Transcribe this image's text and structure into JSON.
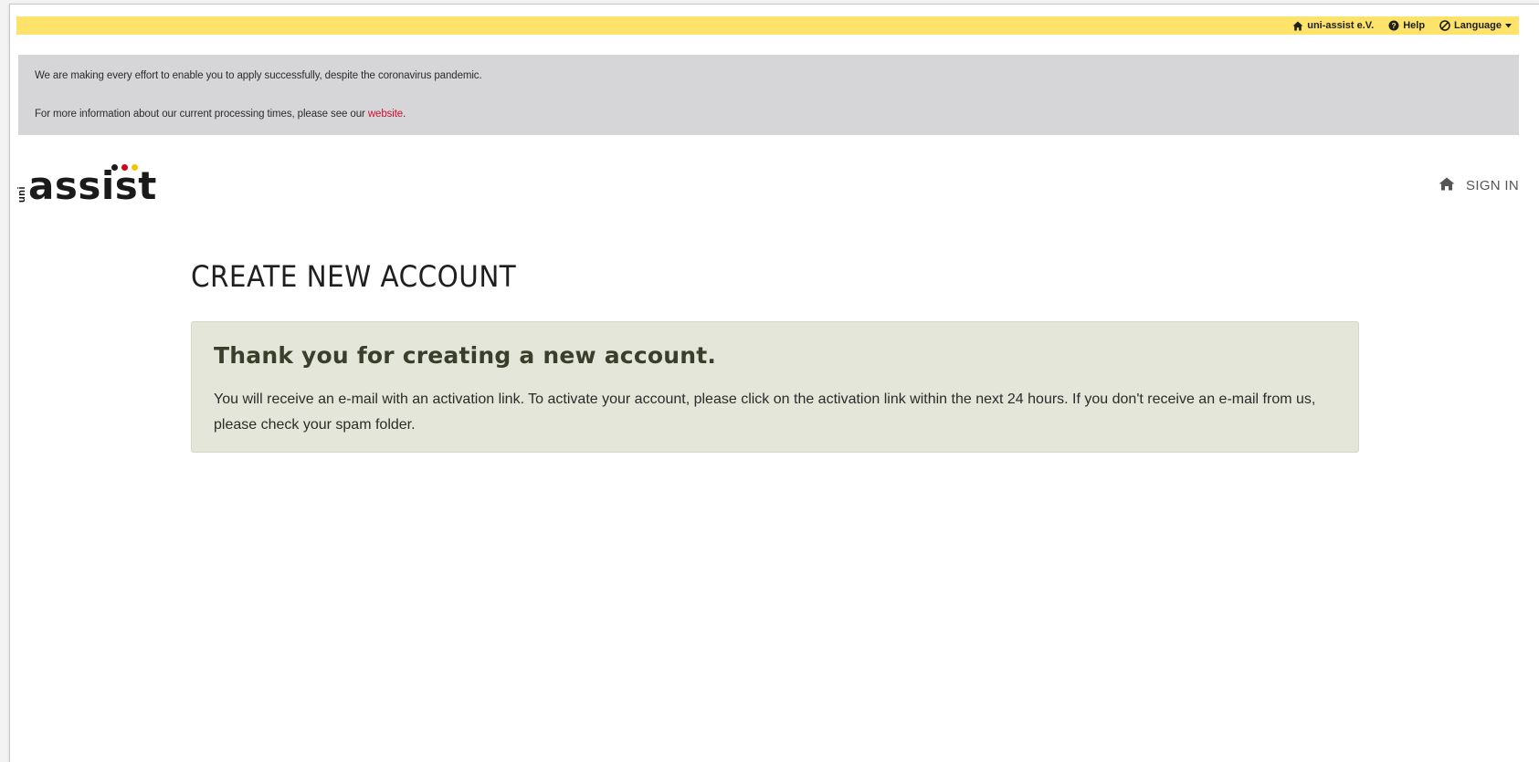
{
  "topbar": {
    "org_label": "uni-assist e.V.",
    "help_label": "Help",
    "language_label": "Language"
  },
  "notice": {
    "line1": "We are making every effort to enable you to apply successfully, despite the coronavirus pandemic.",
    "line2_prefix": "For more information about our current processing times, please see our ",
    "line2_link": "website",
    "line2_suffix": "."
  },
  "logo": {
    "prefix": "uni",
    "word": "assist",
    "dot_colors": [
      "#1a1a1a",
      "#d0021b",
      "#f5c400"
    ]
  },
  "nav": {
    "signin_label": "SIGN IN"
  },
  "page": {
    "title": "CREATE NEW ACCOUNT"
  },
  "alert": {
    "heading": "Thank you for creating a new account.",
    "body": "You will receive an e-mail with an activation link. To activate your account, please click on the activation link within the next 24 hours. If you don't receive an e-mail from us, please check your spam folder."
  },
  "colors": {
    "topbar": "#fde36a",
    "notice_bg": "#d6d6d9",
    "link": "#c8102e",
    "alert_bg": "#e3e6d8"
  }
}
